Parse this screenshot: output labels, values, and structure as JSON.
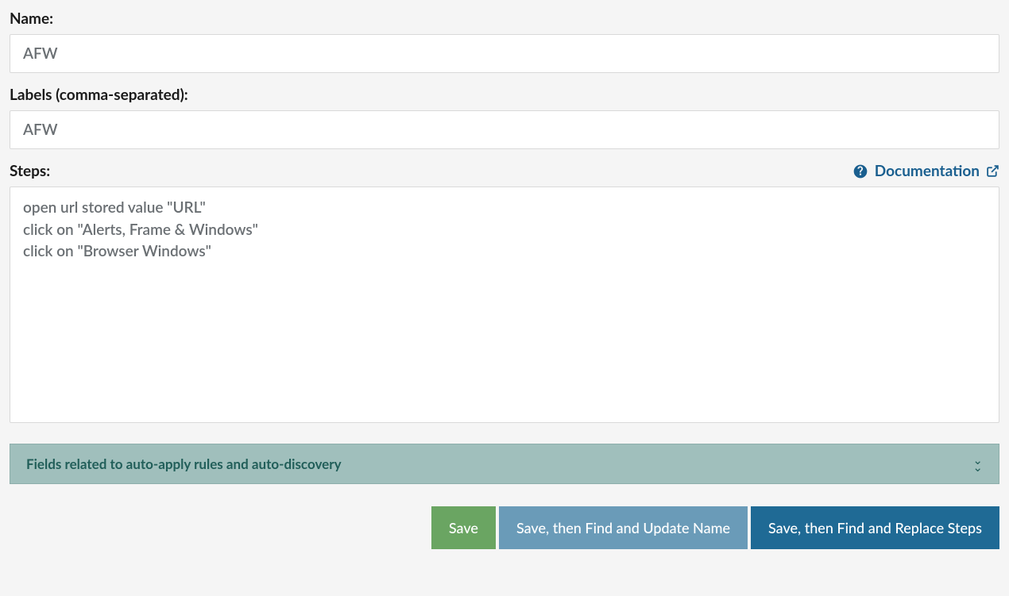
{
  "name": {
    "label": "Name:",
    "value": "AFW"
  },
  "labels": {
    "label": "Labels (comma-separated):",
    "value": "AFW"
  },
  "steps": {
    "label": "Steps:",
    "doc_link": "Documentation",
    "value": "open url stored value \"URL\"\nclick on \"Alerts, Frame & Windows\"\nclick on \"Browser Windows\""
  },
  "accordion": {
    "title": "Fields related to auto-apply rules and auto-discovery"
  },
  "buttons": {
    "save": "Save",
    "save_update_name": "Save, then Find and Update Name",
    "save_replace_steps": "Save, then Find and Replace Steps"
  }
}
